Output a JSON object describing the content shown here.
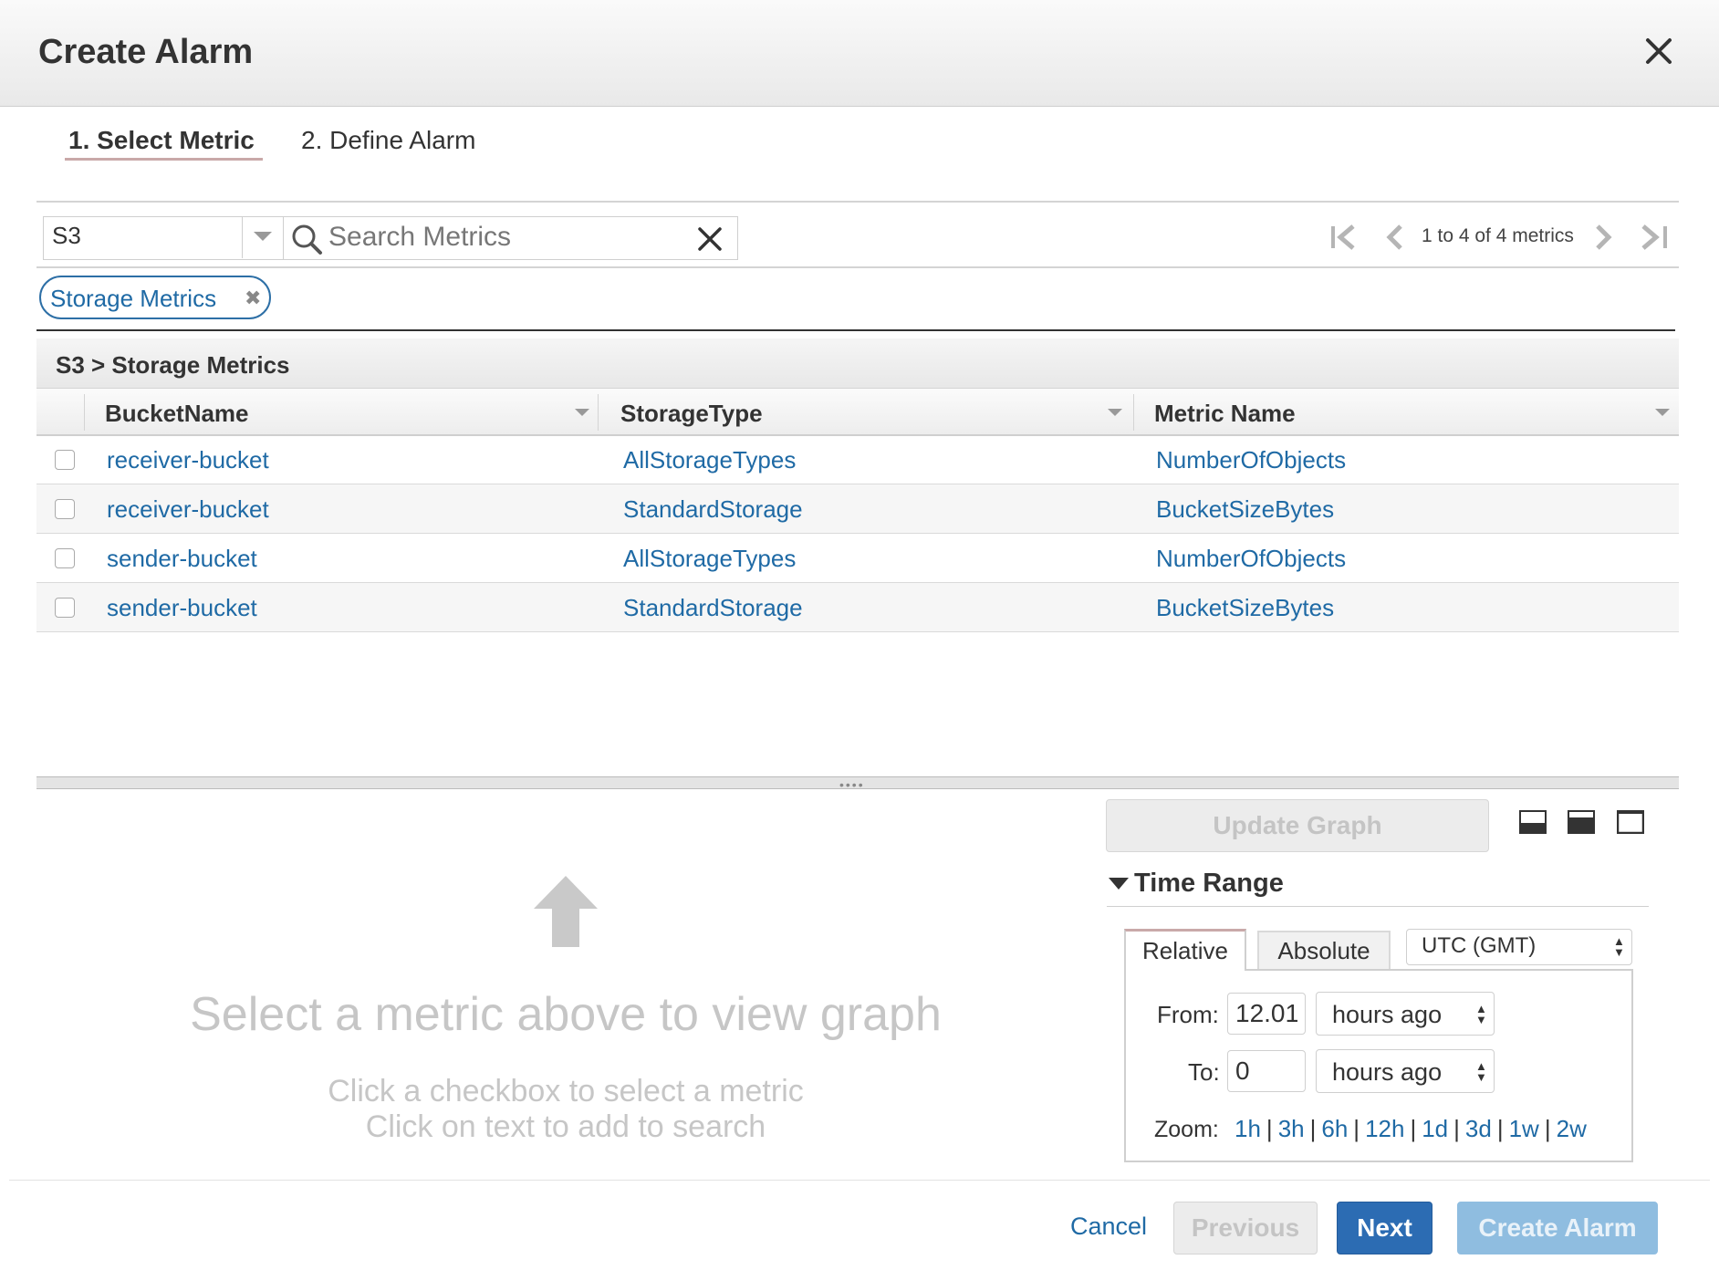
{
  "dialog": {
    "title": "Create Alarm",
    "close_icon": "close-icon"
  },
  "wizard": {
    "steps": [
      {
        "label": "1. Select Metric",
        "active": true
      },
      {
        "label": "2. Define Alarm",
        "active": false
      }
    ]
  },
  "filter": {
    "namespace": "S3",
    "search_placeholder": "Search Metrics",
    "pagination": "1 to 4 of 4 metrics",
    "chip": "Storage Metrics"
  },
  "table": {
    "breadcrumb": "S3 > Storage Metrics",
    "columns": [
      "BucketName",
      "StorageType",
      "Metric Name"
    ],
    "rows": [
      {
        "bucket": "receiver-bucket",
        "storage": "AllStorageTypes",
        "metric": "NumberOfObjects",
        "checked": false
      },
      {
        "bucket": "receiver-bucket",
        "storage": "StandardStorage",
        "metric": "BucketSizeBytes",
        "checked": false
      },
      {
        "bucket": "sender-bucket",
        "storage": "AllStorageTypes",
        "metric": "NumberOfObjects",
        "checked": false
      },
      {
        "bucket": "sender-bucket",
        "storage": "StandardStorage",
        "metric": "BucketSizeBytes",
        "checked": false
      }
    ]
  },
  "graph_placeholder": {
    "title": "Select a metric above to view graph",
    "line1": "Click a checkbox to select a metric",
    "line2": "Click on text to add to search"
  },
  "graph_controls": {
    "update_button": "Update Graph",
    "time_range_title": "Time Range",
    "tabs": {
      "relative": "Relative",
      "absolute": "Absolute",
      "active": "Relative"
    },
    "timezone": "UTC (GMT)",
    "from_label": "From:",
    "from_value": "12.01",
    "from_unit": "hours ago",
    "to_label": "To:",
    "to_value": "0",
    "to_unit": "hours ago",
    "zoom_label": "Zoom:",
    "zoom_options": [
      "1h",
      "3h",
      "6h",
      "12h",
      "1d",
      "3d",
      "1w",
      "2w"
    ]
  },
  "footer": {
    "cancel": "Cancel",
    "previous": "Previous",
    "next": "Next",
    "create": "Create Alarm"
  },
  "colors": {
    "link": "#1f6aa5",
    "primary_button": "#2c6cb3",
    "disabled_primary": "#8fbde0",
    "accent_underline": "#c9a9a9"
  }
}
